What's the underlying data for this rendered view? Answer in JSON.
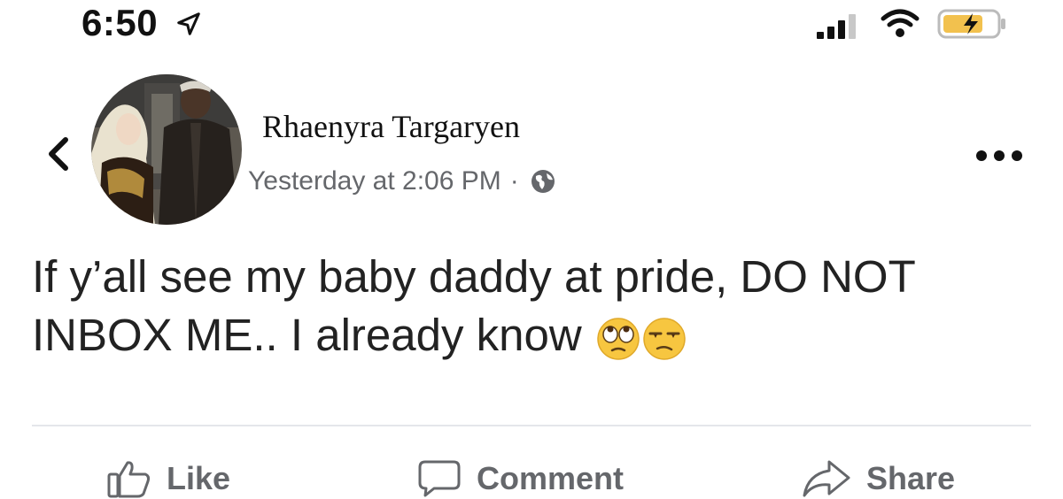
{
  "status_bar": {
    "time": "6:50",
    "icons": [
      "location-arrow-icon",
      "signal-icon",
      "wifi-icon",
      "battery-charging-icon"
    ]
  },
  "post": {
    "author": "Rhaenyra Targaryen",
    "timestamp": "Yesterday at 2:06 PM",
    "separator": "·",
    "privacy_icon": "globe-icon",
    "text": "If y’all see my baby daddy at pride, DO NOT INBOX ME.. I already know",
    "emojis": [
      "eye-roll-emoji",
      "unamused-emoji"
    ]
  },
  "actions": {
    "like": "Like",
    "comment": "Comment",
    "share": "Share"
  },
  "colors": {
    "meta_gray": "#65676b",
    "emoji_yellow": "#f7c640"
  }
}
